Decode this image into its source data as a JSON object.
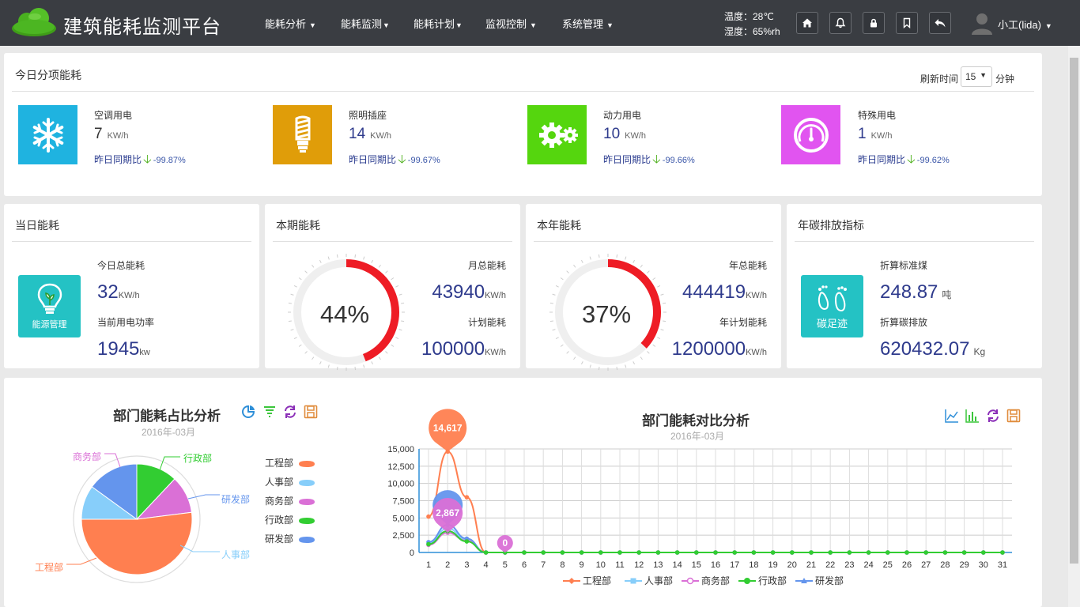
{
  "app": {
    "title": "建筑能耗监测平台"
  },
  "nav": [
    {
      "label": "能耗分析"
    },
    {
      "label": "能耗监测"
    },
    {
      "label": "能耗计划"
    },
    {
      "label": "监视控制"
    },
    {
      "label": "系统管理"
    }
  ],
  "env": {
    "temperature": "温度：28℃",
    "humidity": "湿度：65%rh"
  },
  "user": {
    "name": "小工(lida)"
  },
  "today_items": {
    "title": "今日分项能耗",
    "refresh_label": "刷新时间",
    "refresh_value": "15",
    "refresh_unit": "分钟",
    "compare_label": "昨日同期比",
    "items": [
      {
        "name": "空调用电",
        "value": "7",
        "unit": "KW/h",
        "change": "-99.87%",
        "color": "#1fb3e0",
        "icon": "snowflake-icon"
      },
      {
        "name": "照明插座",
        "value": "14",
        "unit": "KW/h",
        "change": "-99.67%",
        "color": "#e09d09",
        "icon": "bulb-icon"
      },
      {
        "name": "动力用电",
        "value": "10",
        "unit": "KW/h",
        "change": "-99.66%",
        "color": "#55d60e",
        "icon": "gears-icon"
      },
      {
        "name": "特殊用电",
        "value": "1",
        "unit": "KW/h",
        "change": "-99.62%",
        "color": "#e154f0",
        "icon": "gauge-icon"
      }
    ]
  },
  "daily": {
    "title": "当日能耗",
    "icon_label": "能源管理",
    "total_label": "今日总能耗",
    "total_value": "32",
    "total_unit": "KW/h",
    "power_label": "当前用电功率",
    "power_value": "1945",
    "power_unit": "kw"
  },
  "period": {
    "title": "本期能耗",
    "percent": 44,
    "percent_text": "44%",
    "month_label": "月总能耗",
    "month_value": "43940",
    "month_unit": "KW/h",
    "plan_label": "计划能耗",
    "plan_value": "100000",
    "plan_unit": "KW/h"
  },
  "year": {
    "title": "本年能耗",
    "percent": 37,
    "percent_text": "37%",
    "total_label": "年总能耗",
    "total_value": "444419",
    "total_unit": "KW/h",
    "plan_label": "年计划能耗",
    "plan_value": "1200000",
    "plan_unit": "KW/h"
  },
  "carbon": {
    "title": "年碳排放指标",
    "icon_label": "碳足迹",
    "coal_label": "折算标准煤",
    "coal_value": "248.87",
    "coal_unit": "吨",
    "co2_label": "折算碳排放",
    "co2_value": "620432.07",
    "co2_unit": "Kg"
  },
  "colors": {
    "工程部": "#ff7f50",
    "人事部": "#87cefa",
    "商务部": "#da70d6",
    "行政部": "#32cd32",
    "研发部": "#6495ed",
    "gauge": "#ee1c25"
  },
  "chart_data": [
    {
      "type": "pie",
      "title": "部门能耗占比分析",
      "subtitle": "2016年-03月",
      "legend_position": "right",
      "slices": [
        {
          "name": "工程部",
          "value": 52
        },
        {
          "name": "人事部",
          "value": 10
        },
        {
          "name": "研发部",
          "value": 15
        },
        {
          "name": "行政部",
          "value": 12
        },
        {
          "name": "商务部",
          "value": 11
        }
      ]
    },
    {
      "type": "line",
      "title": "部门能耗对比分析",
      "subtitle": "2016年-03月",
      "legend_position": "bottom",
      "grid": true,
      "x": [
        1,
        2,
        3,
        4,
        5,
        6,
        7,
        8,
        9,
        10,
        11,
        12,
        13,
        14,
        15,
        16,
        17,
        18,
        19,
        20,
        21,
        22,
        23,
        24,
        25,
        26,
        27,
        28,
        29,
        30,
        31
      ],
      "ylim": [
        0,
        15000
      ],
      "yticks": [
        "0",
        "2,500",
        "5,000",
        "7,500",
        "10,000",
        "12,500",
        "15,000"
      ],
      "series": [
        {
          "name": "工程部",
          "values": [
            5200,
            14617,
            8000,
            0,
            0,
            0,
            0,
            0,
            0,
            0,
            0,
            0,
            0,
            0,
            0,
            0,
            0,
            0,
            0,
            0,
            0,
            0,
            0,
            0,
            0,
            0,
            0,
            0,
            0,
            0,
            0
          ]
        },
        {
          "name": "人事部",
          "values": [
            1300,
            3500,
            1800,
            0,
            0,
            0,
            0,
            0,
            0,
            0,
            0,
            0,
            0,
            0,
            0,
            0,
            0,
            0,
            0,
            0,
            0,
            0,
            0,
            0,
            0,
            0,
            0,
            0,
            0,
            0,
            0
          ]
        },
        {
          "name": "商务部",
          "values": [
            1100,
            2867,
            1700,
            0,
            0,
            0,
            0,
            0,
            0,
            0,
            0,
            0,
            0,
            0,
            0,
            0,
            0,
            0,
            0,
            0,
            0,
            0,
            0,
            0,
            0,
            0,
            0,
            0,
            0,
            0,
            0
          ]
        },
        {
          "name": "行政部",
          "values": [
            1200,
            3100,
            1600,
            0,
            0,
            0,
            0,
            0,
            0,
            0,
            0,
            0,
            0,
            0,
            0,
            0,
            0,
            0,
            0,
            0,
            0,
            0,
            0,
            0,
            0,
            0,
            0,
            0,
            0,
            0,
            0
          ]
        },
        {
          "name": "研发部",
          "values": [
            1500,
            4000,
            2000,
            0,
            0,
            0,
            0,
            0,
            0,
            0,
            0,
            0,
            0,
            0,
            0,
            0,
            0,
            0,
            0,
            0,
            0,
            0,
            0,
            0,
            0,
            0,
            0,
            0,
            0,
            0,
            0
          ]
        }
      ],
      "markers": [
        {
          "series": "工程部",
          "x": 2,
          "label": "14,617"
        },
        {
          "series": "研发部",
          "x": 2,
          "label": ""
        },
        {
          "series": "商务部",
          "x": 2,
          "label": "2,867"
        },
        {
          "series": "商务部",
          "x": 5,
          "label": "0"
        }
      ]
    }
  ]
}
